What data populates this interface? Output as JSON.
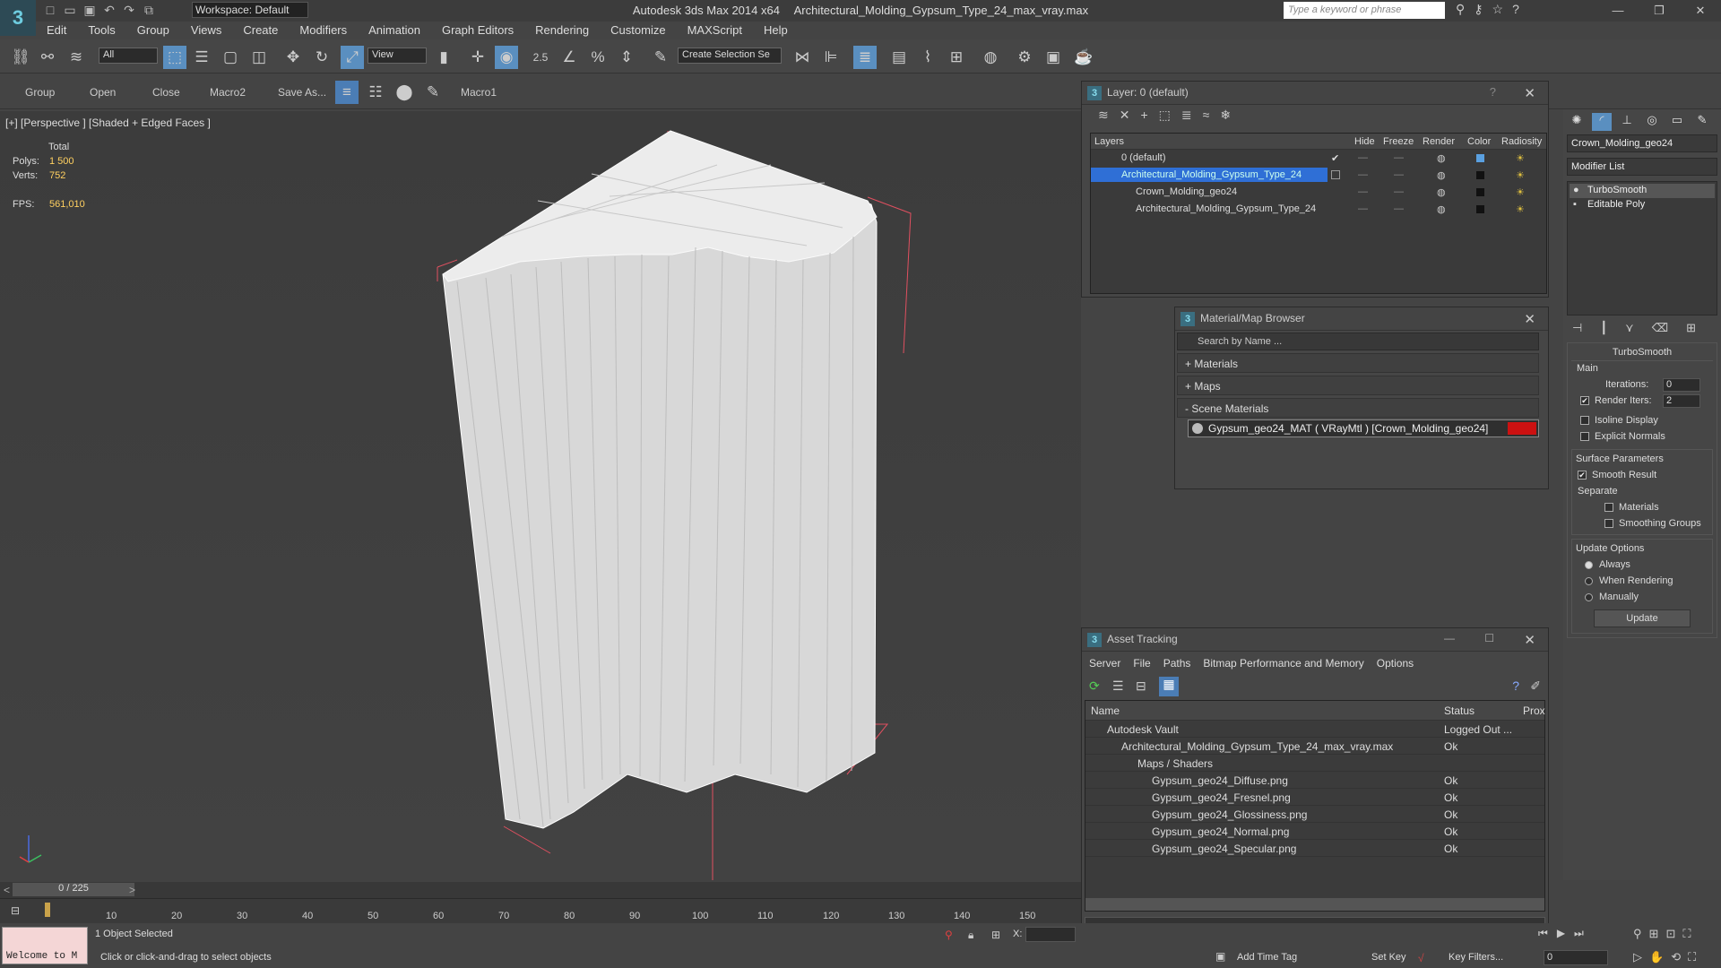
{
  "app": {
    "title": "Autodesk 3ds Max  2014 x64",
    "file": "Architectural_Molding_Gypsum_Type_24_max_vray.max",
    "workspace": "Workspace: Default",
    "search_placeholder": "Type a keyword or phrase",
    "window_controls": [
      "—",
      "❐",
      "✕"
    ]
  },
  "menu": [
    "Edit",
    "Tools",
    "Group",
    "Views",
    "Create",
    "Modifiers",
    "Animation",
    "Graph Editors",
    "Rendering",
    "Customize",
    "MAXScript",
    "Help"
  ],
  "toolbar": {
    "filter": "All",
    "ref_coord": "View",
    "angle_snap": "2.5",
    "selection_set": "Create Selection Se"
  },
  "toolbar2": [
    "Group",
    "Open",
    "Close",
    "Macro2",
    "Save As...",
    "Macro1"
  ],
  "viewport": {
    "label": "[+] [Perspective ] [Shaded + Edged Faces ]",
    "stats_header": "Total",
    "polys_label": "Polys:",
    "polys": "1 500",
    "verts_label": "Verts:",
    "verts": "752",
    "fps_label": "FPS:",
    "fps": "561,010"
  },
  "layer_dialog": {
    "title": "Layer: 0 (default)",
    "help": "?",
    "close": "✕",
    "columns": [
      "Layers",
      "Hide",
      "Freeze",
      "Render",
      "Color",
      "Radiosity"
    ],
    "rows": [
      {
        "name": "0 (default)",
        "color": "#5aa0e0"
      },
      {
        "name": "Architectural_Molding_Gypsum_Type_24",
        "color": "#111111"
      },
      {
        "name": "Crown_Molding_geo24",
        "color": "#111111"
      },
      {
        "name": "Architectural_Molding_Gypsum_Type_24",
        "color": "#111111"
      }
    ]
  },
  "material_browser": {
    "title": "Material/Map Browser",
    "close": "✕",
    "search_placeholder": "Search by Name ...",
    "groups": [
      "+ Materials",
      "+ Maps",
      "- Scene Materials"
    ],
    "material": "Gypsum_geo24_MAT ( VRayMtl ) [Crown_Molding_geo24]",
    "material_swatch": "#cc1111"
  },
  "asset_tracking": {
    "title": "Asset Tracking",
    "window_controls": [
      "—",
      "☐",
      "✕"
    ],
    "menu": [
      "Server",
      "File",
      "Paths",
      "Bitmap Performance and Memory",
      "Options"
    ],
    "columns": [
      "Name",
      "Status",
      "Prox"
    ],
    "rows": [
      {
        "name": "Autodesk Vault",
        "status": "Logged Out ..."
      },
      {
        "name": "Architectural_Molding_Gypsum_Type_24_max_vray.max",
        "status": "Ok"
      },
      {
        "name": "Maps / Shaders",
        "status": ""
      },
      {
        "name": "Gypsum_geo24_Diffuse.png",
        "status": "Ok"
      },
      {
        "name": "Gypsum_geo24_Fresnel.png",
        "status": "Ok"
      },
      {
        "name": "Gypsum_geo24_Glossiness.png",
        "status": "Ok"
      },
      {
        "name": "Gypsum_geo24_Normal.png",
        "status": "Ok"
      },
      {
        "name": "Gypsum_geo24_Specular.png",
        "status": "Ok"
      }
    ]
  },
  "command_panel": {
    "object_name": "Crown_Molding_geo24",
    "modifier_list": "Modifier List",
    "stack": [
      "TurboSmooth",
      "Editable Poly"
    ],
    "rollout_title": "TurboSmooth",
    "main_label": "Main",
    "iterations_label": "Iterations:",
    "iterations": "0",
    "render_iters_label": "Render Iters:",
    "render_iters": "2",
    "isoline": "Isoline Display",
    "explicit_normals": "Explicit Normals",
    "surface_params": "Surface Parameters",
    "smooth_result": "Smooth Result",
    "separate": "Separate",
    "materials": "Materials",
    "smoothing_groups": "Smoothing Groups",
    "update_options": "Update Options",
    "always": "Always",
    "when_rendering": "When Rendering",
    "manually": "Manually",
    "update_button": "Update"
  },
  "timeline": {
    "frame": "0 / 225",
    "ticks": [
      "10",
      "20",
      "30",
      "40",
      "50",
      "60",
      "70",
      "80",
      "90",
      "100",
      "110",
      "120",
      "130",
      "140",
      "150"
    ]
  },
  "status": {
    "listener": "Welcome to M",
    "selection": "1 Object Selected",
    "prompt": "Click or click-and-drag to select objects",
    "add_time_tag": "Add Time Tag",
    "set_key": "Set Key",
    "key_filters": "Key Filters...",
    "x_label": "X:",
    "frame_field": "0"
  }
}
